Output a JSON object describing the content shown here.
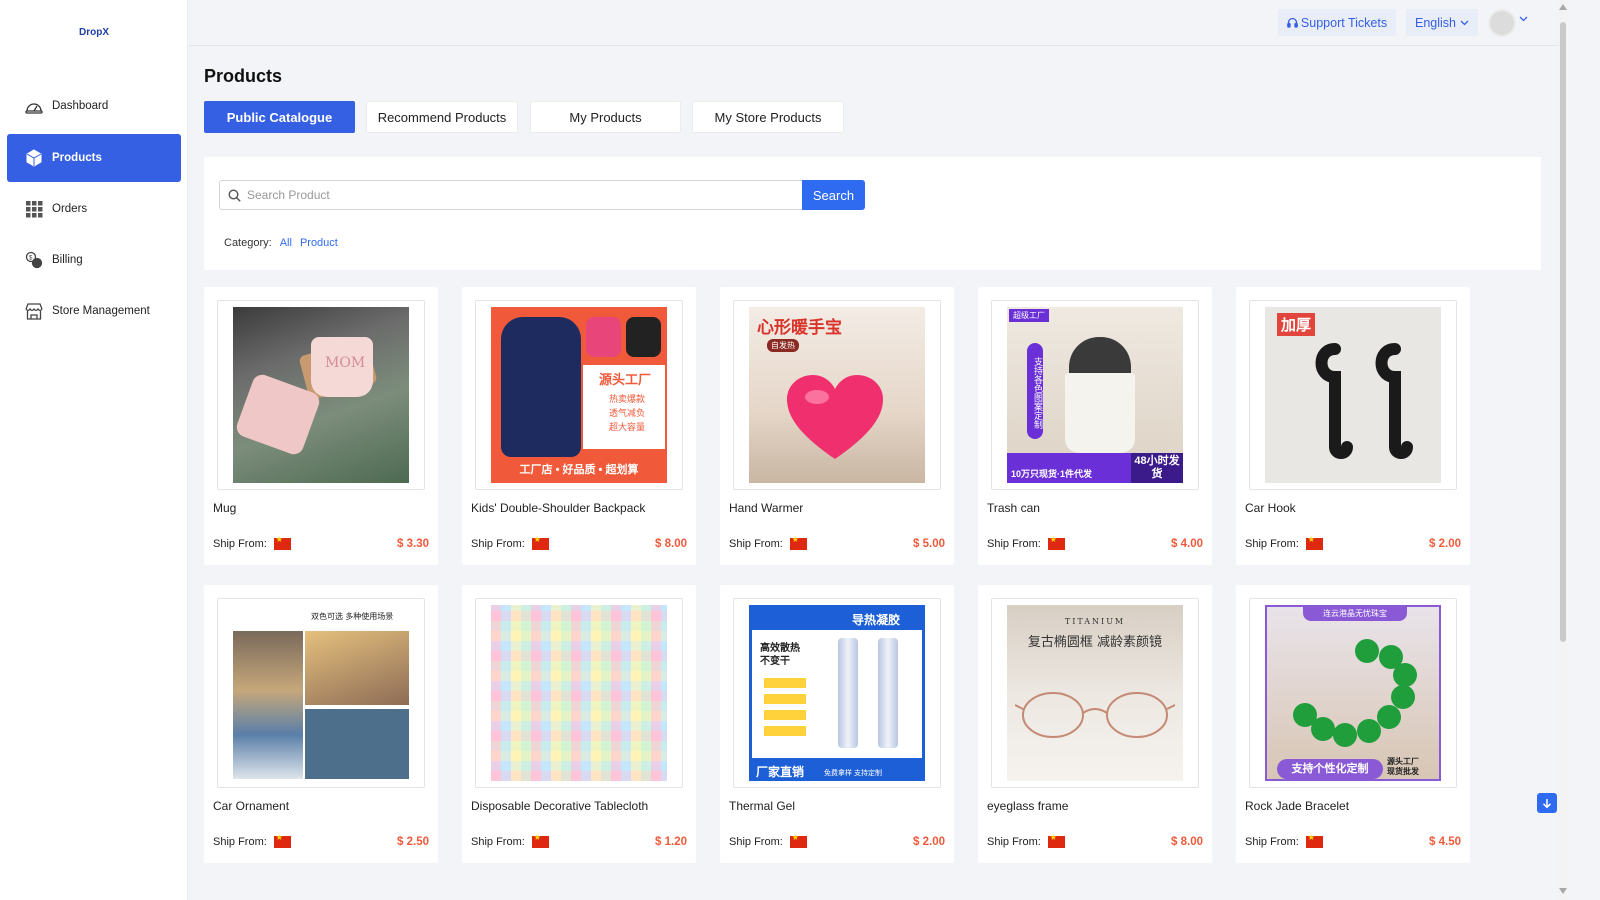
{
  "app": {
    "logo": "DropX"
  },
  "sidebar": {
    "items": [
      {
        "label": "Dashboard",
        "icon": "dashboard-gauge-icon",
        "active": false
      },
      {
        "label": "Products",
        "icon": "box-icon",
        "active": true
      },
      {
        "label": "Orders",
        "icon": "grid-icon",
        "active": false
      },
      {
        "label": "Billing",
        "icon": "coins-icon",
        "active": false
      },
      {
        "label": "Store Management",
        "icon": "store-icon",
        "active": false
      }
    ]
  },
  "topbar": {
    "support_label": "Support Tickets",
    "support_icon": "headset-icon",
    "language": "English",
    "language_icon": "chevron-down-icon",
    "avatar_icon": "user-avatar-icon"
  },
  "main": {
    "title": "Products",
    "tabs": [
      {
        "label": "Public Catalogue",
        "active": true
      },
      {
        "label": "Recommend Products",
        "active": false
      },
      {
        "label": "My Products",
        "active": false
      },
      {
        "label": "My Store Products",
        "active": false
      }
    ],
    "search": {
      "placeholder": "Search Product",
      "value": "",
      "button_label": "Search",
      "icon": "search-icon"
    },
    "category": {
      "label": "Category:",
      "options": [
        "All",
        "Product"
      ]
    }
  },
  "products": [
    {
      "name": "Mug",
      "ship_from_label": "Ship From:",
      "ship_flag": "china-flag-icon",
      "price": "$ 3.30"
    },
    {
      "name": "Kids' Double-Shoulder Backpack",
      "ship_from_label": "Ship From:",
      "ship_flag": "china-flag-icon",
      "price": "$ 8.00",
      "image_text": [
        "源头工厂",
        "热卖爆款",
        "透气减负",
        "超大容量",
        "工厂店 • 好品质 • 超划算"
      ]
    },
    {
      "name": "Hand Warmer",
      "ship_from_label": "Ship From:",
      "ship_flag": "china-flag-icon",
      "price": "$ 5.00",
      "image_text": [
        "心形暖手宝",
        "自发热"
      ]
    },
    {
      "name": "Trash can",
      "ship_from_label": "Ship From:",
      "ship_flag": "china-flag-icon",
      "price": "$ 4.00",
      "image_text": [
        "超级工厂",
        "支持各色图案定制",
        "10万只现货·1件代发",
        "48小时发货"
      ]
    },
    {
      "name": "Car Hook",
      "ship_from_label": "Ship From:",
      "ship_flag": "china-flag-icon",
      "price": "$ 2.00",
      "image_text": [
        "加厚"
      ]
    },
    {
      "name": "Car Ornament",
      "ship_from_label": "Ship From:",
      "ship_flag": "china-flag-icon",
      "price": "$ 2.50",
      "image_text": [
        "双色可选 多种使用场景"
      ]
    },
    {
      "name": "Disposable Decorative Tablecloth",
      "ship_from_label": "Ship From:",
      "ship_flag": "china-flag-icon",
      "price": "$ 1.20"
    },
    {
      "name": "Thermal Gel",
      "ship_from_label": "Ship From:",
      "ship_flag": "china-flag-icon",
      "price": "$ 2.00",
      "image_text": [
        "导热凝胶",
        "高效散热",
        "不变干",
        "厂家直销",
        "免费拿样 支持定制"
      ]
    },
    {
      "name": "eyeglass frame",
      "ship_from_label": "Ship From:",
      "ship_flag": "china-flag-icon",
      "price": "$ 8.00",
      "image_text": [
        "TITANIUM",
        "复古椭圆框 减龄素颜镜"
      ]
    },
    {
      "name": "Rock Jade Bracelet",
      "ship_from_label": "Ship From:",
      "ship_flag": "china-flag-icon",
      "price": "$ 4.50",
      "image_text": [
        "连云港晶无忧珠宝",
        "支持个性化定制",
        "源头工厂",
        "现货批发"
      ]
    }
  ],
  "floating": {
    "icon": "arrow-down-icon"
  },
  "colors": {
    "accent": "#3660e3",
    "search_button": "#2f6bf1",
    "price": "#f05a3a",
    "background": "#f3f4f7"
  }
}
